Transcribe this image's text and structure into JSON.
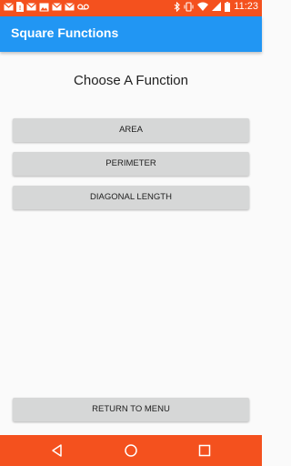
{
  "status_bar": {
    "time": "11:23",
    "color": "#f4511e",
    "left_icons": [
      "email-icon",
      "sim-icon",
      "email-icon",
      "image-icon",
      "email-icon",
      "email-icon",
      "voicemail-icon"
    ],
    "right_icons": [
      "bluetooth-icon",
      "vibrate-icon",
      "wifi-icon",
      "signal-icon",
      "battery-icon"
    ]
  },
  "app_bar": {
    "title": "Square Functions",
    "color": "#2196f3"
  },
  "main": {
    "heading": "Choose A Function",
    "buttons": [
      {
        "label": "AREA"
      },
      {
        "label": "PERIMETER"
      },
      {
        "label": "DIAGONAL LENGTH"
      }
    ],
    "return_button": {
      "label": "RETURN TO MENU"
    }
  },
  "nav_bar": {
    "color": "#f4511e",
    "icons": [
      "back-icon",
      "home-icon",
      "recents-icon"
    ]
  }
}
